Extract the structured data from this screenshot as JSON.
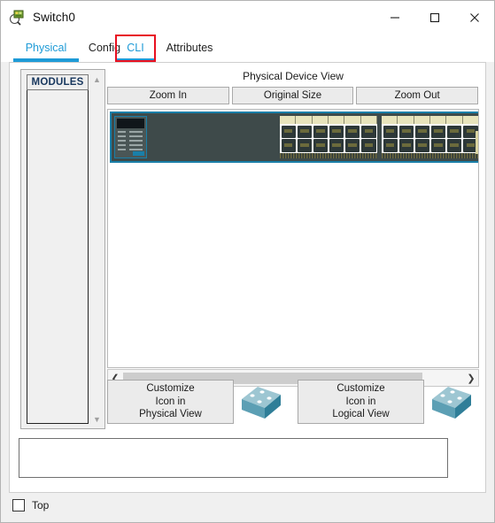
{
  "window": {
    "title": "Switch0",
    "icon": "packet-tracer-device-icon",
    "controls": {
      "minimize": "—",
      "maximize": "☐",
      "close": "✕"
    }
  },
  "tabs": [
    {
      "label": "Physical",
      "active": true,
      "highlighted": false
    },
    {
      "label": "Config",
      "active": false,
      "highlighted": false
    },
    {
      "label": "CLI",
      "active": true,
      "highlighted": true
    },
    {
      "label": "Attributes",
      "active": false,
      "highlighted": false
    }
  ],
  "modules": {
    "header": "MODULES",
    "items": [],
    "scroll_up_icon": "▲",
    "scroll_down_icon": "▼"
  },
  "device_view": {
    "title": "Physical Device View",
    "zoom_buttons": [
      {
        "label": "Zoom In"
      },
      {
        "label": "Original Size"
      },
      {
        "label": "Zoom Out"
      }
    ],
    "hscroll": {
      "left_icon": "❮",
      "right_icon": "❯"
    }
  },
  "customize": [
    {
      "line1": "Customize",
      "line2": "Icon in",
      "line3": "Physical View",
      "icon": "switch-3d-icon"
    },
    {
      "line1": "Customize",
      "line2": "Icon in",
      "line3": "Logical View",
      "icon": "switch-3d-icon"
    }
  ],
  "description_field": {
    "value": "",
    "placeholder": ""
  },
  "bottom": {
    "top_checkbox_label": "Top",
    "top_checkbox_checked": false
  },
  "colors": {
    "accent_blue": "#1e9bd7",
    "highlight_red": "#e81020",
    "chassis_teal": "#1a7fa8",
    "chassis_body": "#3e4a4a",
    "icon_teal": "#4f97b0",
    "panel_gray": "#f0f0f0"
  }
}
